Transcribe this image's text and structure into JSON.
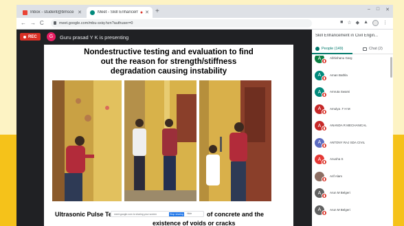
{
  "colors": {
    "accent": "#00796b",
    "record": "#d93025",
    "presenter_avatar": "#e91e63",
    "meet_bg": "#202124",
    "outer_bg": "#fdf3c4",
    "banner": "#f5c21a"
  },
  "browser": {
    "tabs": [
      {
        "title": "Inbox - student@bmsce",
        "icon": "gmail-icon",
        "active": false
      },
      {
        "title": "Meet - Skill Enhancement",
        "icon": "meet-icon",
        "active": true
      }
    ],
    "new_tab": "+",
    "controls": {
      "minimize": "–",
      "maximize": "□",
      "close": "✕"
    },
    "nav": {
      "back": "←",
      "forward": "→",
      "reload": "C"
    },
    "url": "meet.google.com/mbu-sxiq-hzn?authuser=0"
  },
  "meeting": {
    "rec_label": "REC",
    "presenter_initial": "G",
    "presenter_text": "Guru prasad Y K is presenting"
  },
  "slide": {
    "title_lines": [
      "Nondestructive testing and evaluation to find",
      "out the reason for strength/stiffness",
      "degradation  causing instability"
    ],
    "bottom_left": "Ultrasonic Pulse Test",
    "bottom_right": "of concrete and the",
    "bottom_line2": "existence of voids or cracks",
    "share_pill": {
      "text": "meet.google.com is sharing your screen",
      "stop_label": "Stop sharing",
      "hide_label": "Hide"
    }
  },
  "panel": {
    "title": "Skill Enhancement in Civil Engin...",
    "tab_people": "People (149)",
    "tab_chat": "Chat (2)",
    "participants": [
      {
        "name": "Abhishanu Garg",
        "initial": "A",
        "color": "#0b8043"
      },
      {
        "name": "Aman Bathla",
        "initial": "A",
        "color": "#00897b"
      },
      {
        "name": "Amruta Swami",
        "initial": "A",
        "color": "#00897b"
      },
      {
        "name": "Amulya .T H M",
        "initial": "A",
        "color": "#c62828"
      },
      {
        "name": "ANANDA R MECHANICAL",
        "initial": "A",
        "color": "#c62828"
      },
      {
        "name": "ANTONY RAJ SDA CIVIL",
        "initial": "A",
        "color": "#5c6bc0"
      },
      {
        "name": "Anusha S",
        "initial": "A",
        "color": "#e53935"
      },
      {
        "name": "Arif Alam",
        "initial": "",
        "color": "#8d6e63"
      },
      {
        "name": "Arun M Belgeri",
        "initial": "A",
        "color": "#616161"
      },
      {
        "name": "Arun M Belgeri",
        "initial": "A",
        "color": "#616161"
      }
    ]
  }
}
